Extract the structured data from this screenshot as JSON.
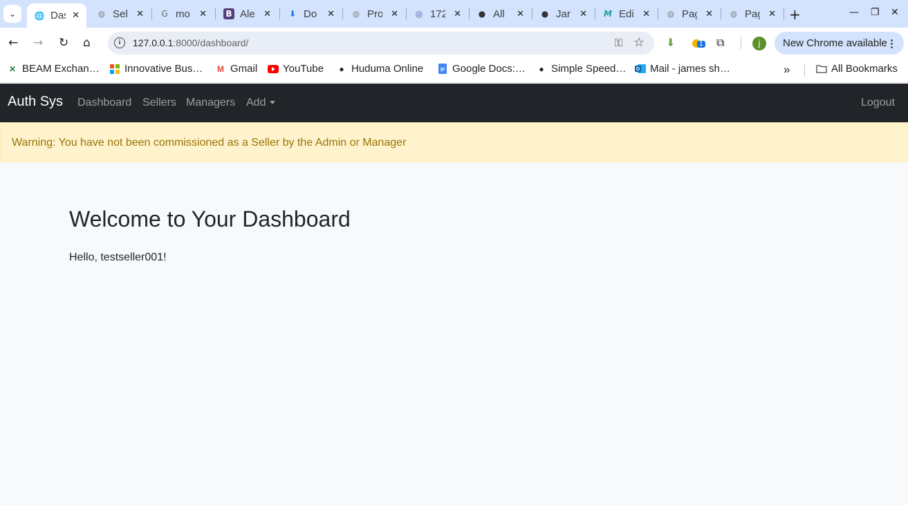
{
  "browser": {
    "tabs": [
      {
        "title": "Das",
        "icon": "globe-icon",
        "active": true
      },
      {
        "title": "Sel",
        "icon": "globe-icon"
      },
      {
        "title": "mo",
        "icon": "google-icon"
      },
      {
        "title": "Ale",
        "icon": "bootstrap-icon"
      },
      {
        "title": "Do",
        "icon": "download-icon"
      },
      {
        "title": "Pro",
        "icon": "globe-icon"
      },
      {
        "title": "172",
        "icon": "globe-icon"
      },
      {
        "title": "All",
        "icon": "github-icon"
      },
      {
        "title": "Jar",
        "icon": "github-icon"
      },
      {
        "title": "Edi",
        "icon": "m-icon"
      },
      {
        "title": "Pag",
        "icon": "globe-icon"
      },
      {
        "title": "Pag",
        "icon": "globe-icon"
      }
    ],
    "address": {
      "host": "127.0.0.1",
      "rest": ":8000/dashboard/"
    },
    "update_label": "New Chrome available",
    "avatar_letter": "j",
    "extension_badge": "1",
    "bookmarks": [
      {
        "label": "BEAM Exchan…",
        "icon": "beam-icon"
      },
      {
        "label": "Innovative Bus…",
        "icon": "microsoft-icon"
      },
      {
        "label": "Gmail",
        "icon": "gmail-icon"
      },
      {
        "label": "YouTube",
        "icon": "youtube-icon"
      },
      {
        "label": "Huduma Online",
        "icon": "globe-icon"
      },
      {
        "label": "Google Docs:…",
        "icon": "docs-icon"
      },
      {
        "label": "Simple Speed…",
        "icon": "globe-icon"
      },
      {
        "label": "Mail - james sh…",
        "icon": "outlook-icon"
      }
    ],
    "all_bookmarks_label": "All Bookmarks"
  },
  "app": {
    "brand": "Auth Sys",
    "nav": {
      "dashboard": "Dashboard",
      "sellers": "Sellers",
      "managers": "Managers",
      "add": "Add",
      "logout": "Logout"
    },
    "alert": "Warning: You have not been commissioned as a Seller by the Admin or Manager",
    "title": "Welcome to Your Dashboard",
    "greeting": "Hello, testseller001!"
  }
}
